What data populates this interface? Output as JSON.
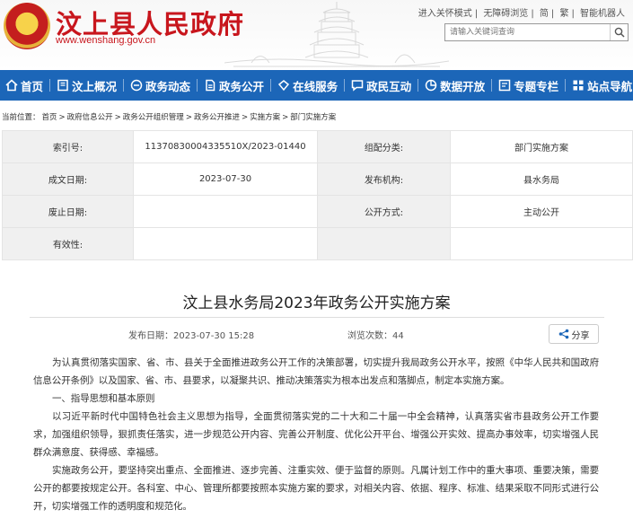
{
  "header": {
    "site_title": "汶上县人民政府",
    "domain": "www.wenshang.gov.cn",
    "top_links": [
      "进入关怀模式",
      "无障碍浏览",
      "简",
      "繁",
      "智能机器人"
    ],
    "search_placeholder": "请输入关键词查询"
  },
  "nav": [
    "首页",
    "汶上概况",
    "政务动态",
    "政务公开",
    "在线服务",
    "政民互动",
    "数据开放",
    "专题专栏",
    "站点导航"
  ],
  "breadcrumb": [
    "当前位置：",
    "首页",
    ">",
    "政府信息公开",
    ">",
    "政务公开组织管理",
    ">",
    "政务公开推进",
    ">",
    "实施方案",
    ">",
    "部门实施方案"
  ],
  "info": {
    "index_label": "索引号:",
    "index_value": "11370830004335510X/2023-01440",
    "category_label": "组配分类:",
    "category_value": "部门实施方案",
    "date_label": "成文日期:",
    "date_value": "2023-07-30",
    "org_label": "发布机构:",
    "org_value": "县水务局",
    "expire_label": "废止日期:",
    "expire_value": "",
    "method_label": "公开方式:",
    "method_value": "主动公开",
    "valid_label": "有效性:",
    "valid_value": ""
  },
  "article": {
    "title": "汶上县水务局2023年政务公开实施方案",
    "publish_time": "发布日期：2023-07-30 15:28",
    "views": "浏览次数：44",
    "share_label": "分享",
    "paragraphs": [
      "为认真贯彻落实国家、省、市、县关于全面推进政务公开工作的决策部署，切实提升我局政务公开水平，按照《中华人民共和国政府信息公开条例》以及国家、省、市、县要求，以凝聚共识、推动决策落实为根本出发点和落脚点，制定本实施方案。",
      "一、指导思想和基本原则",
      "以习近平新时代中国特色社会主义思想为指导，全面贯彻落实党的二十大和二十届一中全会精神，认真落实省市县政务公开工作要求，加强组织领导，狠抓责任落实，进一步规范公开内容、完善公开制度、优化公开平台、增强公开实效、提高办事效率，切实增强人民群众满意度、获得感、幸福感。",
      "实施政务公开，要坚持突出重点、全面推进、逐步完善、注重实效、便于监督的原则。凡属计划工作中的重大事项、重要决策，需要公开的都要按规定公开。各科室、中心、管理所都要按照本实施方案的要求，对相关内容、依据、程序、标准、结果采取不同形式进行公开，切实增强工作的透明度和规范化。"
    ]
  },
  "colors": {
    "nav_bg": "#1c66b8",
    "title_red": "#c8161d"
  }
}
